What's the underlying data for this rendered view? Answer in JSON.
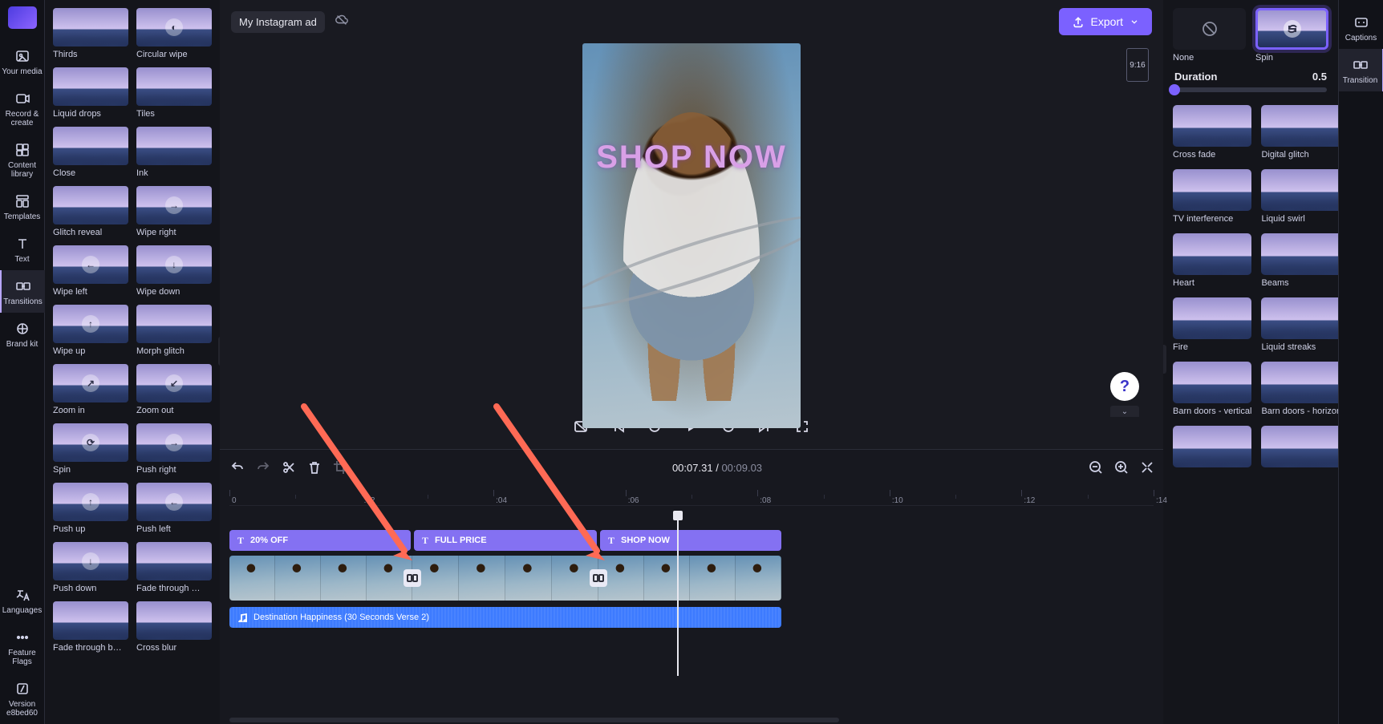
{
  "project": {
    "title": "My Instagram ad"
  },
  "export": {
    "label": "Export"
  },
  "aspect": {
    "label": "9:16"
  },
  "leftRail": {
    "tabs": [
      {
        "id": "your-media",
        "label": "Your media"
      },
      {
        "id": "record-create",
        "label": "Record & create"
      },
      {
        "id": "content-library",
        "label": "Content library"
      },
      {
        "id": "templates",
        "label": "Templates"
      },
      {
        "id": "text",
        "label": "Text"
      },
      {
        "id": "transitions",
        "label": "Transitions",
        "active": true
      },
      {
        "id": "brand-kit",
        "label": "Brand kit"
      },
      {
        "id": "languages",
        "label": "Languages"
      },
      {
        "id": "feature-flags",
        "label": "Feature Flags"
      },
      {
        "id": "version",
        "label": "Version e8bed60"
      }
    ]
  },
  "transitionsList": [
    {
      "label": "Thirds"
    },
    {
      "label": "Circular wipe"
    },
    {
      "label": "Liquid drops"
    },
    {
      "label": "Tiles"
    },
    {
      "label": "Close"
    },
    {
      "label": "Ink"
    },
    {
      "label": "Glitch reveal"
    },
    {
      "label": "Wipe right"
    },
    {
      "label": "Wipe left"
    },
    {
      "label": "Wipe down"
    },
    {
      "label": "Wipe up"
    },
    {
      "label": "Morph glitch"
    },
    {
      "label": "Zoom in"
    },
    {
      "label": "Zoom out"
    },
    {
      "label": "Spin"
    },
    {
      "label": "Push right"
    },
    {
      "label": "Push up"
    },
    {
      "label": "Push left"
    },
    {
      "label": "Push down"
    },
    {
      "label": "Fade through …"
    },
    {
      "label": "Fade through b…"
    },
    {
      "label": "Cross blur"
    }
  ],
  "preview": {
    "overlayText": "SHOP NOW"
  },
  "playback": {
    "current": "00:07.31",
    "sep": "/",
    "total": "00:09.03"
  },
  "rightPanel": {
    "selected": {
      "none": "None",
      "spin": "Spin"
    },
    "duration": {
      "label": "Duration",
      "value": "0.5"
    },
    "options": [
      {
        "label": "Cross fade"
      },
      {
        "label": "Digital glitch"
      },
      {
        "label": "TV interference"
      },
      {
        "label": "Liquid swirl"
      },
      {
        "label": "Heart"
      },
      {
        "label": "Beams"
      },
      {
        "label": "Fire"
      },
      {
        "label": "Liquid streaks"
      },
      {
        "label": "Barn doors - vertical"
      },
      {
        "label": "Barn doors - horizontal"
      }
    ]
  },
  "rightRail": {
    "tabs": [
      {
        "id": "captions",
        "label": "Captions"
      },
      {
        "id": "transition",
        "label": "Transition",
        "active": true
      }
    ]
  },
  "timeline": {
    "ruler": [
      "0",
      ":02",
      ":04",
      ":06",
      ":08",
      ":10",
      ":12",
      ":14"
    ],
    "textClips": [
      {
        "label": "20% OFF"
      },
      {
        "label": "FULL PRICE"
      },
      {
        "label": "SHOP NOW"
      }
    ],
    "audio": {
      "label": "Destination Happiness (30 Seconds Verse 2)"
    }
  },
  "colors": {
    "accent": "#7b61ff",
    "textClip": "#8471F2",
    "audioClip": "#3d7bff",
    "annotationArrow": "#ff6a55"
  }
}
